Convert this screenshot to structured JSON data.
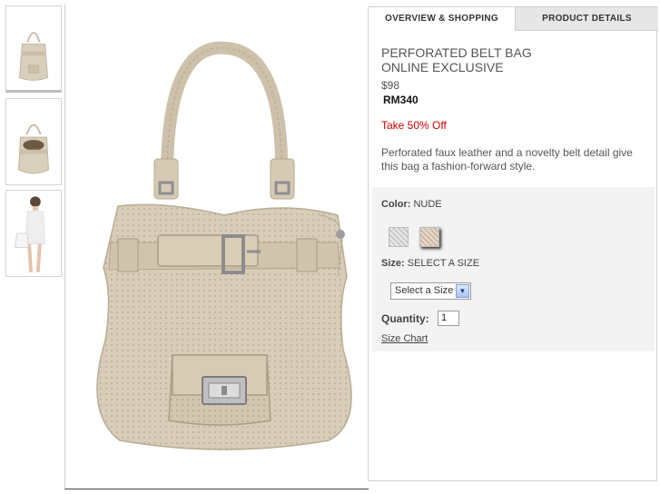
{
  "thumbnails": [
    {
      "label": "bag-front-thumbnail"
    },
    {
      "label": "bag-open-thumbnail"
    },
    {
      "label": "model-carrying-bag-thumbnail"
    }
  ],
  "colors": {
    "bag": "#d7ccb7",
    "bag_dark": "#b8ab93",
    "hardware": "#9a9a9a",
    "sale": "#cc0000"
  },
  "tabs": {
    "overview": "OVERVIEW & SHOPPING",
    "details": "PRODUCT DETAILS"
  },
  "product": {
    "title_line1": "PERFORATED BELT BAG",
    "title_line2": "ONLINE EXCLUSIVE",
    "price": "$98",
    "price_rm": "RM340",
    "sale": "Take 50% Off",
    "description": "Perforated faux leather and a novelty belt detail give this bag a fashion-forward style."
  },
  "options": {
    "color_label": "Color:",
    "color_value": "NUDE",
    "swatches": [
      "grey",
      "nude"
    ],
    "size_label": "Size:",
    "size_value": "SELECT A SIZE",
    "size_select": "Select a Size",
    "quantity_label": "Quantity:",
    "quantity_value": "1",
    "size_chart": "Size Chart"
  }
}
